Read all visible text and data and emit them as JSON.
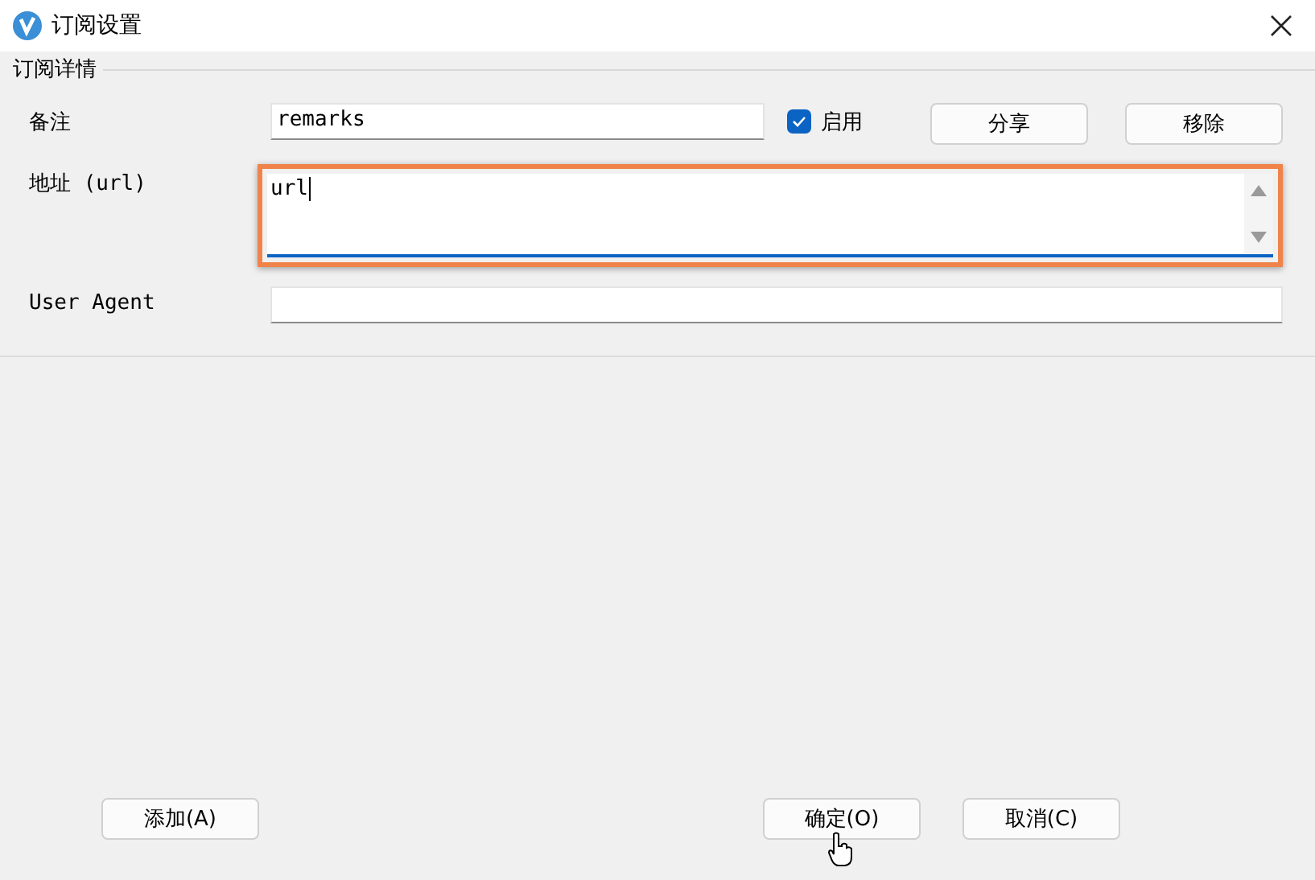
{
  "window": {
    "title": "订阅设置"
  },
  "group": {
    "title": "订阅详情"
  },
  "remark": {
    "label": "备注",
    "value": "remarks"
  },
  "enabled": {
    "label": "启用",
    "checked": true
  },
  "row_buttons": [
    "分享",
    "移除"
  ],
  "url": {
    "label": "地址 (url)",
    "value": "url",
    "focused": true
  },
  "user_agent": {
    "label": "User Agent"
  },
  "footer_left": [
    "添加(A)"
  ],
  "footer_right": [
    "确定(O)",
    "取消(C)"
  ]
}
